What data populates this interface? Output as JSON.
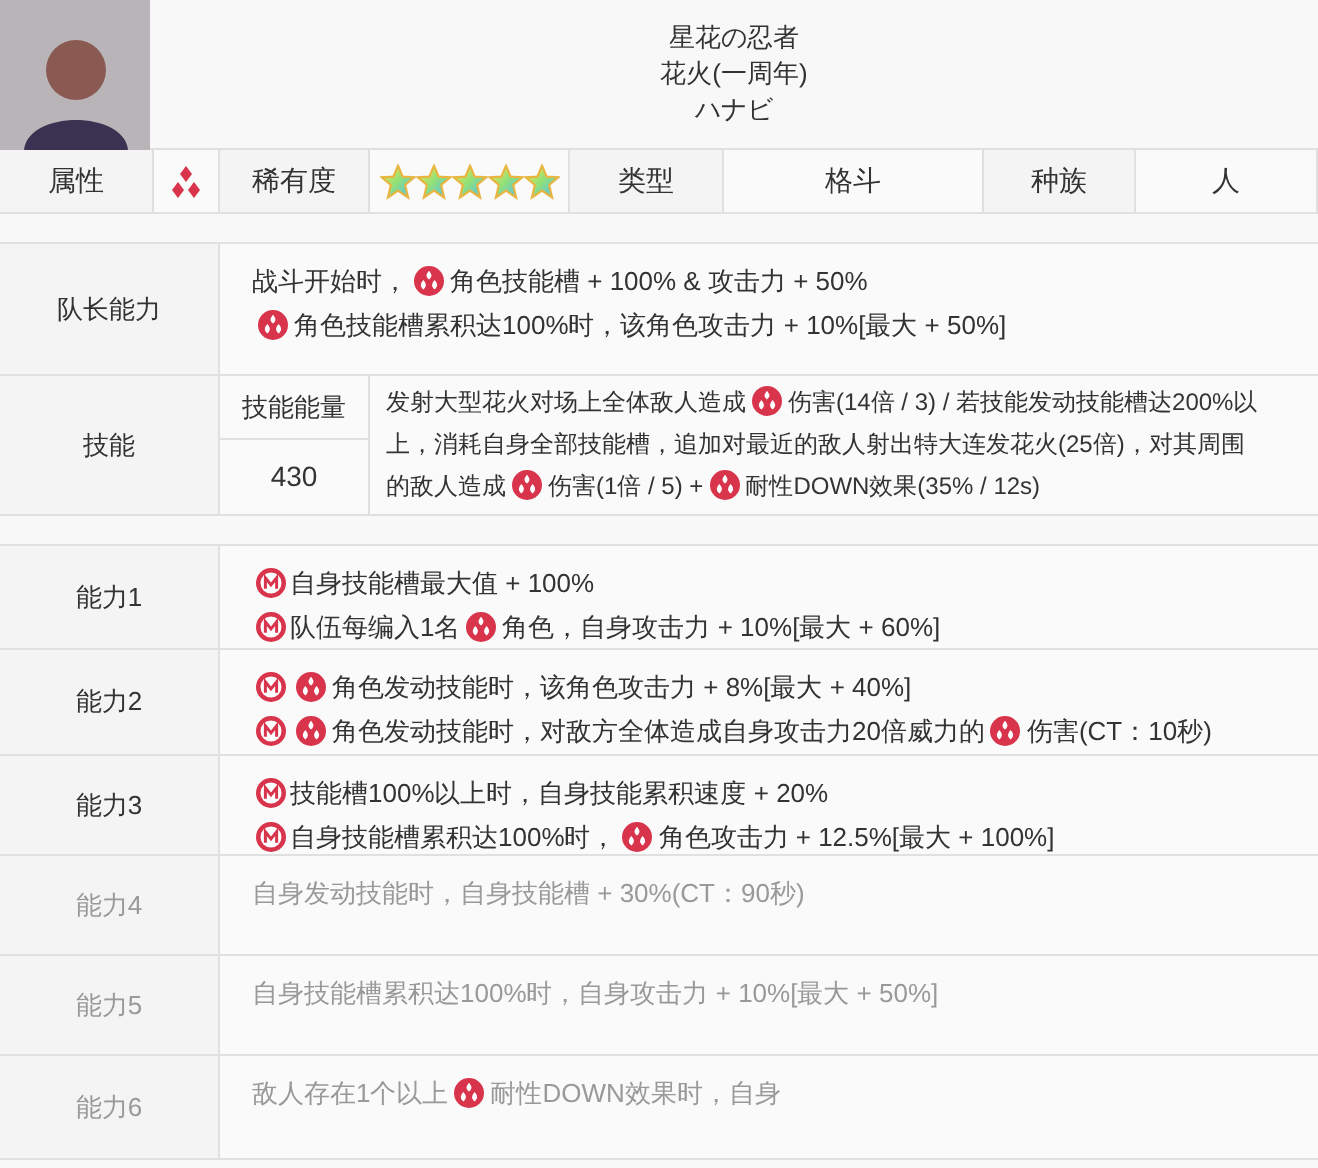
{
  "character": {
    "names": [
      "星花の忍者",
      "花火(一周年)",
      "ハナビ"
    ]
  },
  "stats": [
    {
      "kind": "label",
      "text": "属性"
    },
    {
      "kind": "attribute"
    },
    {
      "kind": "label",
      "text": "稀有度"
    },
    {
      "kind": "stars",
      "stars": 5
    },
    {
      "kind": "label",
      "text": "类型"
    },
    {
      "kind": "value",
      "text": "格斗"
    },
    {
      "kind": "label",
      "text": "种族"
    },
    {
      "kind": "value",
      "text": "人"
    }
  ],
  "leader": {
    "label": "队长能力",
    "lines": [
      [
        {
          "kind": "text",
          "text": "战斗开始时，"
        },
        {
          "kind": "element"
        },
        {
          "kind": "text",
          "text": "角色技能槽 + 100% & 攻击力 + 50%"
        }
      ],
      [
        {
          "kind": "element"
        },
        {
          "kind": "text",
          "text": "角色技能槽累积达100%时，该角色攻击力 + 10%[最大 + 50%]"
        }
      ]
    ]
  },
  "skill": {
    "label": "技能",
    "energy_label": "技能能量",
    "energy": "430",
    "lines": [
      [
        {
          "kind": "text",
          "text": "发射大型花火对场上全体敌人造成"
        },
        {
          "kind": "element"
        },
        {
          "kind": "text",
          "text": "伤害(14倍 / 3) / 若技能发动技能槽达200%以"
        }
      ],
      [
        {
          "kind": "text",
          "text": "上，消耗自身全部技能槽，追加对最近的敌人射出特大连发花火(25倍)，对其周围"
        }
      ],
      [
        {
          "kind": "text",
          "text": "的敌人造成"
        },
        {
          "kind": "element"
        },
        {
          "kind": "text",
          "text": "伤害(1倍 / 5) +"
        },
        {
          "kind": "element"
        },
        {
          "kind": "text",
          "text": "耐性DOWN效果(35% / 12s)"
        }
      ]
    ]
  },
  "abilities": [
    {
      "label": "能力1",
      "disabled": false,
      "lines": [
        [
          {
            "kind": "m"
          },
          {
            "kind": "text",
            "text": "自身技能槽最大值 + 100%"
          }
        ],
        [
          {
            "kind": "m"
          },
          {
            "kind": "text",
            "text": "队伍每编入1名"
          },
          {
            "kind": "element"
          },
          {
            "kind": "text",
            "text": "角色，自身攻击力 + 10%[最大 + 60%]"
          }
        ]
      ]
    },
    {
      "label": "能力2",
      "disabled": false,
      "lines": [
        [
          {
            "kind": "m"
          },
          {
            "kind": "element"
          },
          {
            "kind": "text",
            "text": "角色发动技能时，该角色攻击力 + 8%[最大 + 40%]"
          }
        ],
        [
          {
            "kind": "m"
          },
          {
            "kind": "element"
          },
          {
            "kind": "text",
            "text": "角色发动技能时，对敌方全体造成自身攻击力20倍威力的"
          },
          {
            "kind": "element"
          },
          {
            "kind": "text",
            "text": "伤害(CT：10秒)"
          }
        ]
      ]
    },
    {
      "label": "能力3",
      "disabled": false,
      "lines": [
        [
          {
            "kind": "m"
          },
          {
            "kind": "text",
            "text": "技能槽100%以上时，自身技能累积速度 + 20%"
          }
        ],
        [
          {
            "kind": "m"
          },
          {
            "kind": "text",
            "text": "自身技能槽累积达100%时，"
          },
          {
            "kind": "element"
          },
          {
            "kind": "text",
            "text": "角色攻击力 + 12.5%[最大 + 100%]"
          }
        ]
      ]
    },
    {
      "label": "能力4",
      "disabled": true,
      "lines": [
        [
          {
            "kind": "text",
            "text": "自身发动技能时，自身技能槽 + 30%(CT：90秒)"
          }
        ]
      ]
    },
    {
      "label": "能力5",
      "disabled": true,
      "lines": [
        [
          {
            "kind": "text",
            "text": "自身技能槽累积达100%时，自身攻击力 + 10%[最大 + 50%]"
          }
        ]
      ]
    },
    {
      "label": "能力6",
      "disabled": true,
      "lines": [
        [
          {
            "kind": "text",
            "text": "敌人存在1个以上"
          },
          {
            "kind": "element"
          },
          {
            "kind": "text",
            "text": "耐性DOWN效果时，自身"
          }
        ]
      ]
    }
  ]
}
